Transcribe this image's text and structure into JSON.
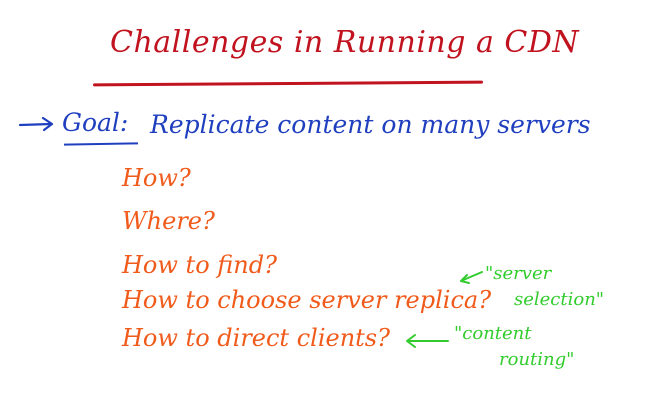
{
  "slide": {
    "title": "Challenges in Running a CDN",
    "goal": {
      "label": "Goal:",
      "text": "Replicate content on many servers"
    },
    "questions": [
      "How?",
      "Where?",
      "How to find?",
      "How to choose server replica?",
      "How to direct clients?"
    ],
    "notes": {
      "server_selection": [
        "\"server",
        "selection\""
      ],
      "content_routing": [
        "\"content",
        "routing\""
      ]
    },
    "colors": {
      "title": "#c1121f",
      "goal": "#1f3fbf",
      "questions": "#f05a1a",
      "notes": "#33cc2e"
    },
    "icons": {
      "goal_marker": "right-arrow-icon",
      "note_pointer": "left-arrow-icon"
    }
  }
}
